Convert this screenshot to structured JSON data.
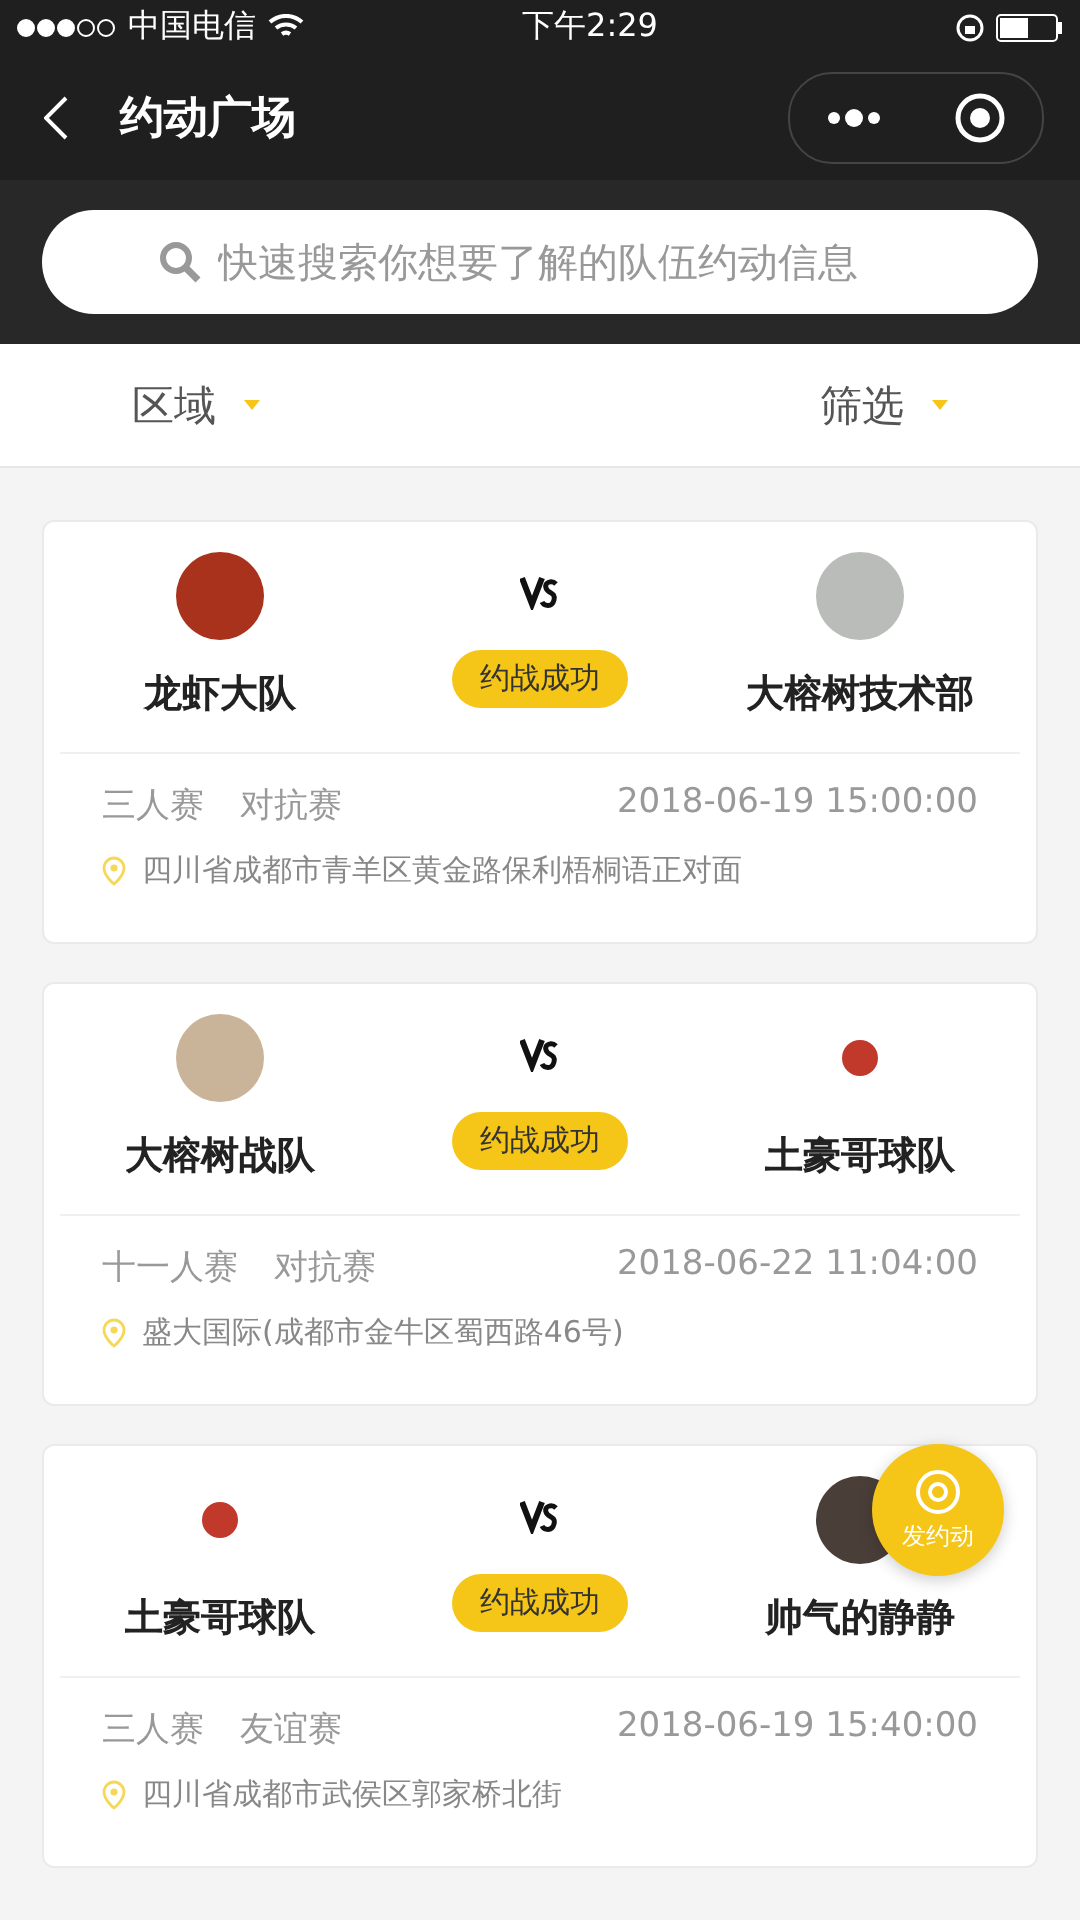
{
  "status_bar": {
    "carrier": "中国电信",
    "time": "下午2:29"
  },
  "nav": {
    "title": "约动广场"
  },
  "search": {
    "placeholder": "快速搜索你想要了解的队伍约动信息"
  },
  "filters": [
    {
      "label": "区域"
    },
    {
      "label": "筛选"
    }
  ],
  "matches": [
    {
      "home": {
        "name": "龙虾大队",
        "kind": "photo",
        "color": "#a8321c"
      },
      "away": {
        "name": "大榕树技术部",
        "kind": "photo",
        "color": "#b9bcb8"
      },
      "status": "约战成功",
      "format": "三人赛",
      "type": "对抗赛",
      "time": "2018-06-19 15:00:00",
      "address": "四川省成都市青羊区黄金路保利梧桐语正对面"
    },
    {
      "home": {
        "name": "大榕树战队",
        "kind": "photo",
        "color": "#c9b49a"
      },
      "away": {
        "name": "土豪哥球队",
        "kind": "cartoon",
        "color": "#c0392b"
      },
      "status": "约战成功",
      "format": "十一人赛",
      "type": "对抗赛",
      "time": "2018-06-22 11:04:00",
      "address": "盛大国际(成都市金牛区蜀西路46号)"
    },
    {
      "home": {
        "name": "土豪哥球队",
        "kind": "cartoon",
        "color": "#c0392b"
      },
      "away": {
        "name": "帅气的静静",
        "kind": "photo",
        "color": "#4a3f38"
      },
      "status": "约战成功",
      "format": "三人赛",
      "type": "友谊赛",
      "time": "2018-06-19 15:40:00",
      "address": "四川省成都市武侯区郭家桥北街"
    }
  ],
  "fab": {
    "label": "发约动"
  }
}
